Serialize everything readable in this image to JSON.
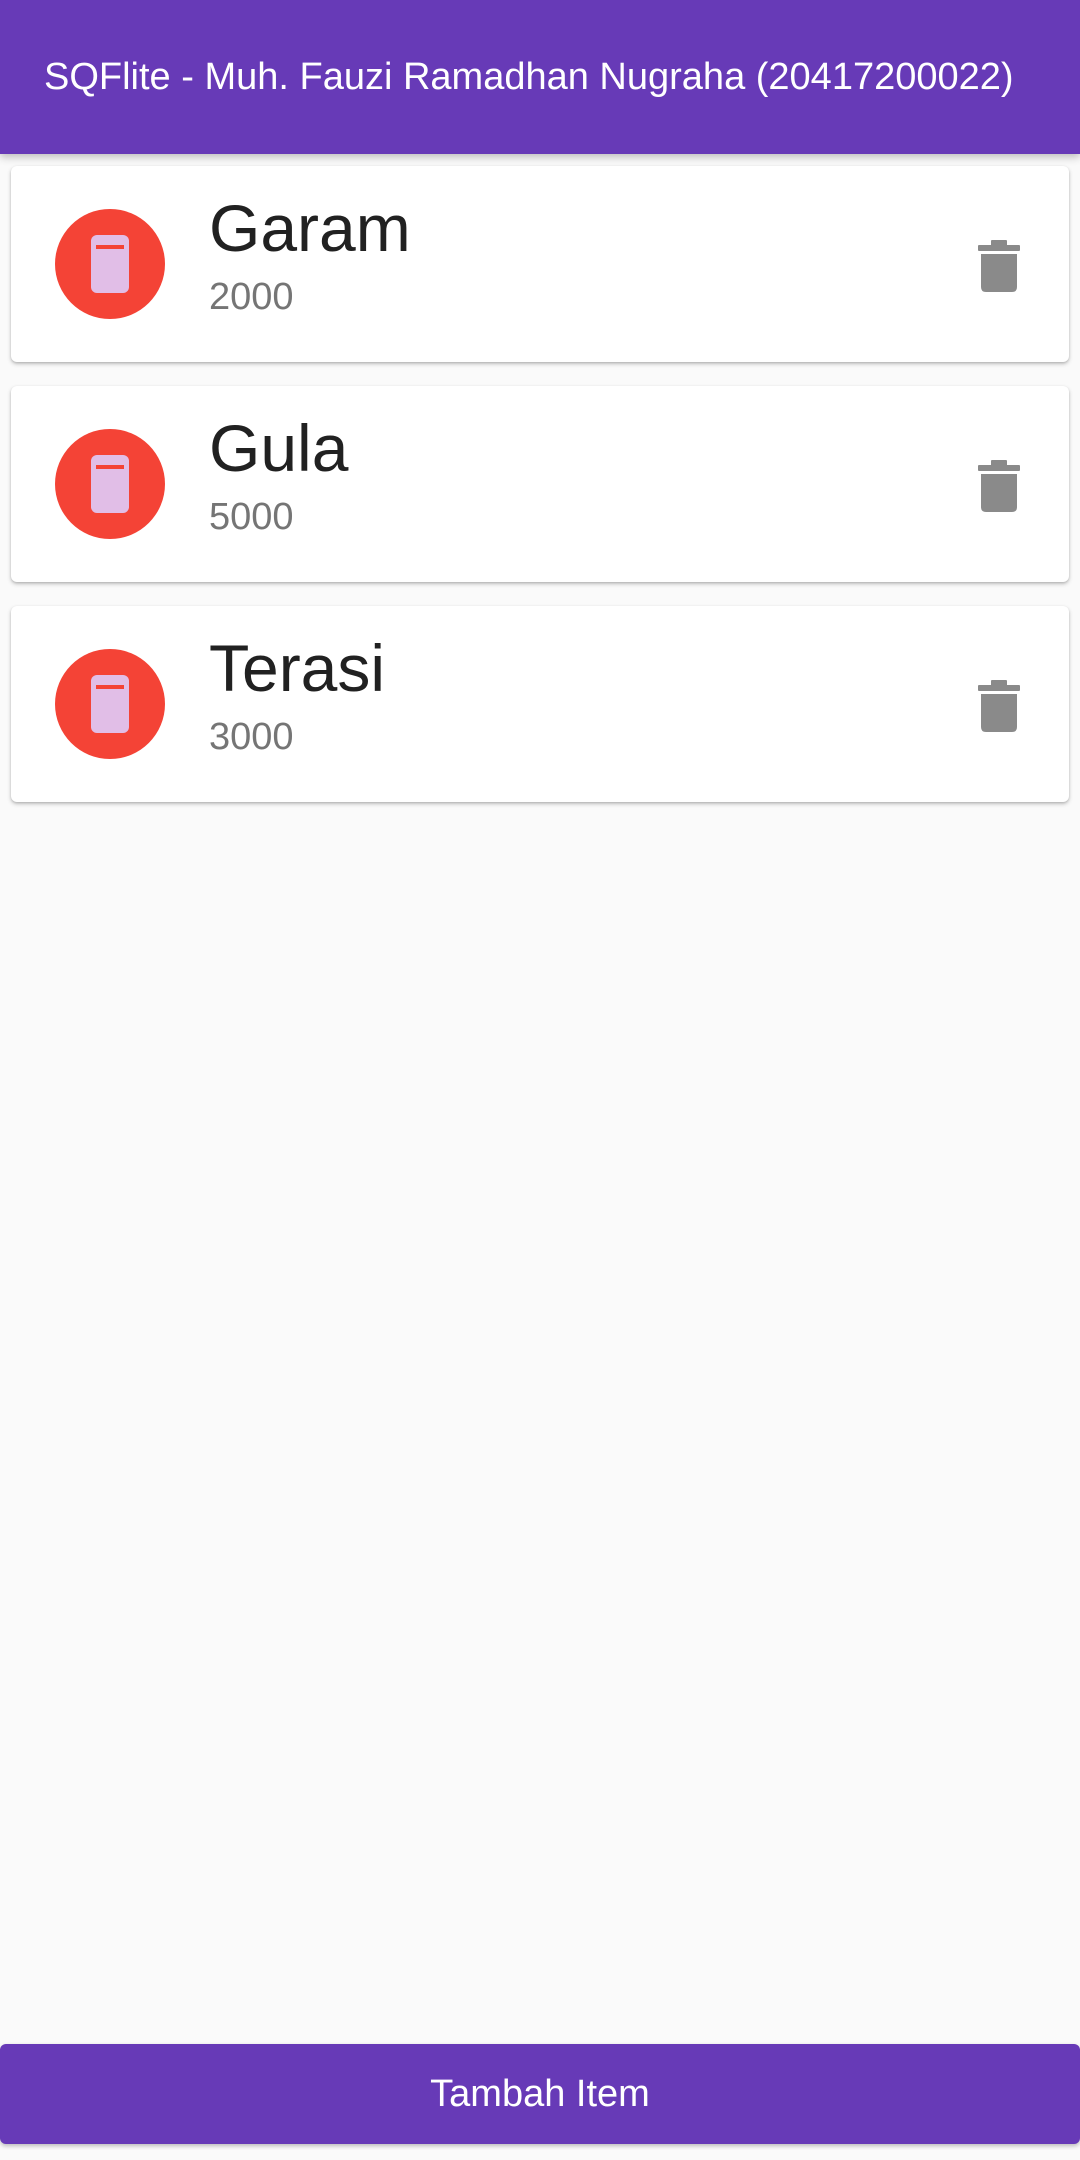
{
  "appbar": {
    "title": "SQFlite - Muh. Fauzi Ramadhan Nugraha (20417200022)",
    "color": "#673ab7"
  },
  "items": [
    {
      "title": "Garam",
      "subtitle": "2000",
      "icon": "phone-icon",
      "action_icon": "trash-icon"
    },
    {
      "title": "Gula",
      "subtitle": "5000",
      "icon": "phone-icon",
      "action_icon": "trash-icon"
    },
    {
      "title": "Terasi",
      "subtitle": "3000",
      "icon": "phone-icon",
      "action_icon": "trash-icon"
    }
  ],
  "footer": {
    "button_label": "Tambah Item"
  },
  "colors": {
    "accent": "#673ab7",
    "avatar": "#f44336",
    "avatar_icon": "#e1bee7",
    "delete_icon": "#8a8a8a",
    "background": "#fafafa"
  }
}
